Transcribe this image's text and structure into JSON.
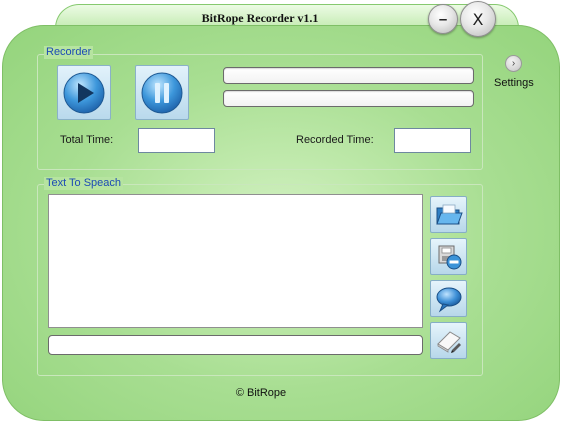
{
  "window": {
    "title": "BitRope Recorder v1.1",
    "minimize_label": "–",
    "close_label": "X"
  },
  "recorder": {
    "legend": "Recorder",
    "play_icon": "play-icon",
    "pause_icon": "pause-icon",
    "total_time_label": "Total Time:",
    "total_time_value": "",
    "recorded_time_label": "Recorded Time:",
    "recorded_time_value": "",
    "progress_primary": 0,
    "progress_secondary": 0
  },
  "settings": {
    "arrow": "›",
    "label": "Settings"
  },
  "tts": {
    "legend": "Text To Speach",
    "text_value": "",
    "input_value": "",
    "buttons": [
      {
        "icon": "open-folder-icon"
      },
      {
        "icon": "save-disk-icon"
      },
      {
        "icon": "speech-bubble-icon"
      },
      {
        "icon": "edit-pencil-icon"
      }
    ]
  },
  "footer": {
    "copyright": "© BitRope"
  },
  "colors": {
    "window_green": "#a8de92",
    "legend_blue": "#1d4bb5",
    "button_blue": "#3a8ed0"
  }
}
